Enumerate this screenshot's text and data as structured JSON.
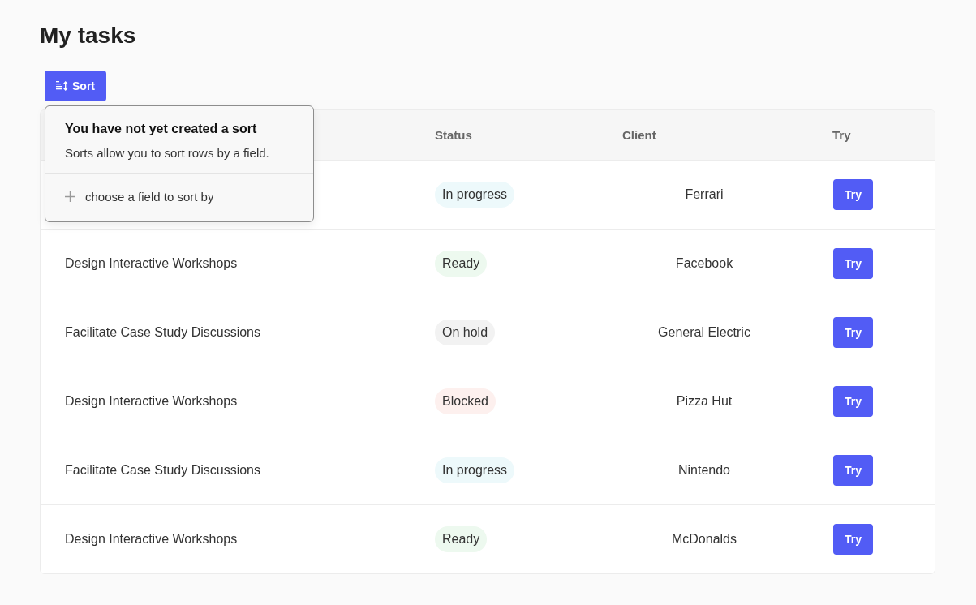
{
  "title": "My tasks",
  "sort_button": {
    "label": "Sort"
  },
  "sort_popover": {
    "heading": "You have not yet created a sort",
    "description": "Sorts allow you to sort rows by a field.",
    "add_field": "choose a field to sort by"
  },
  "table": {
    "columns": [
      "Status",
      "Client",
      "Try"
    ],
    "rows": [
      {
        "status": {
          "label": "In progress",
          "color": "#edf9fb"
        },
        "client": "Ferrari",
        "action": "Try"
      },
      {
        "task": "Design Interactive Workshops",
        "status": {
          "label": "Ready",
          "color": "#edf9ef"
        },
        "client": "Facebook",
        "action": "Try"
      },
      {
        "task": "Facilitate Case Study Discussions",
        "status": {
          "label": "On hold",
          "color": "#f2f2f2"
        },
        "client": "General Electric",
        "action": "Try"
      },
      {
        "task": "Design Interactive Workshops",
        "status": {
          "label": "Blocked",
          "color": "#fdf0ee"
        },
        "client": "Pizza Hut",
        "action": "Try"
      },
      {
        "task": "Facilitate Case Study Discussions",
        "status": {
          "label": "In progress",
          "color": "#edf9fb"
        },
        "client": "Nintendo",
        "action": "Try"
      },
      {
        "task": "Design Interactive Workshops",
        "status": {
          "label": "Ready",
          "color": "#edf9ef"
        },
        "client": "McDonalds",
        "action": "Try"
      }
    ]
  }
}
